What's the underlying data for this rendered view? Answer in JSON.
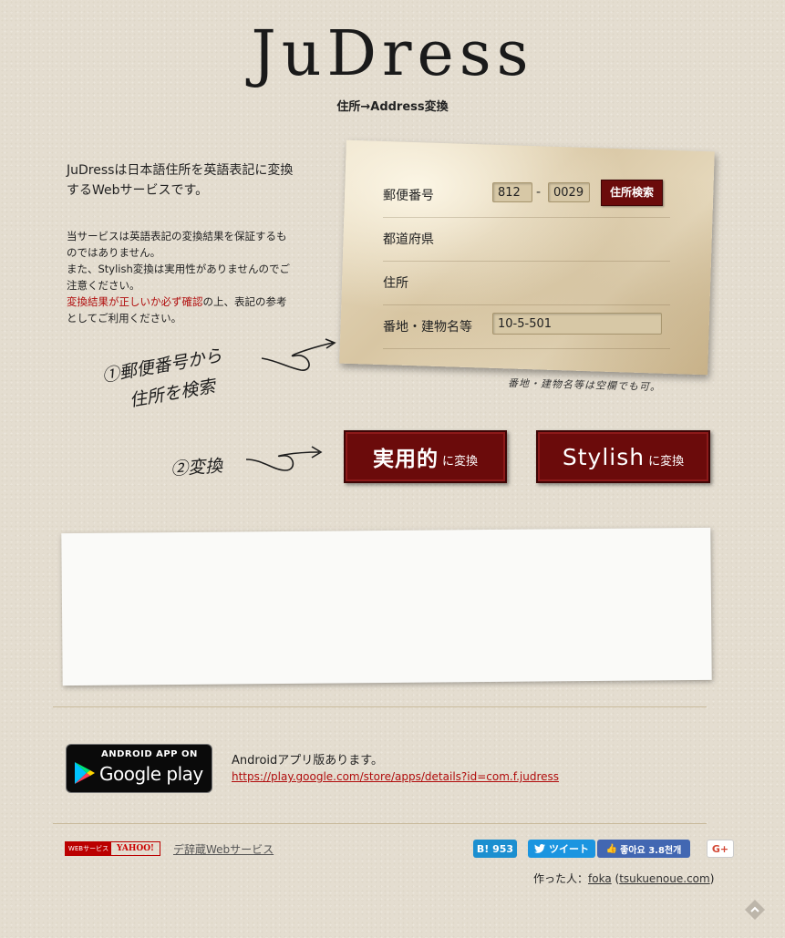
{
  "header": {
    "logo": "JuDress",
    "tagline": "住所→Address変換"
  },
  "intro": {
    "lead": "JuDressは日本語住所を英語表記に変換するWebサービスです。",
    "disclaimer_1": "当サービスは英語表記の変換結果を保証するものではありません。",
    "disclaimer_2": "また、Stylish変換は実用性がありませんのでご注意ください。",
    "disclaimer_red": "変換結果が正しいか必ず確認",
    "disclaimer_3": "の上、表記の参考としてご利用ください。"
  },
  "form": {
    "zip_label": "郵便番号",
    "zip_first": "812",
    "zip_dash": "-",
    "zip_second": "0029",
    "search_button": "住所検索",
    "prefecture_label": "都道府県",
    "address_label": "住所",
    "building_label": "番地・建物名等",
    "building_value": "10-5-501"
  },
  "notes": {
    "address_note": "番地・建物名等は空欄でも可。",
    "step1_line1": "①郵便番号から",
    "step1_line2": "住所を検索",
    "step2": "②変換"
  },
  "convert": {
    "practical_main": "実用的",
    "practical_sub": "に変換",
    "stylish_main": "Stylish",
    "stylish_sub": "に変換"
  },
  "android": {
    "badge_top": "ANDROID APP ON",
    "badge_bottom": "Google play",
    "text": "Androidアプリ版あります。",
    "link": "https://play.google.com/store/apps/details?id=com.f.judress"
  },
  "footer": {
    "yahoo_left": "WEBサービス",
    "yahoo_right": "YAHOO!",
    "dejizo": "デ辞蔵Webサービス",
    "hatena": "B! 953",
    "tweet": "ツイート",
    "like": "좋아요 3.8천개",
    "gplus": "G+",
    "credits_prefix": "作った人：",
    "credits_author": "foka",
    "credits_open": " (",
    "credits_site": "tsukuenoue.com",
    "credits_close": ")"
  },
  "colors": {
    "accent": "#6b0b0b",
    "warning": "#b00d0d",
    "background": "#e4ddd0"
  }
}
